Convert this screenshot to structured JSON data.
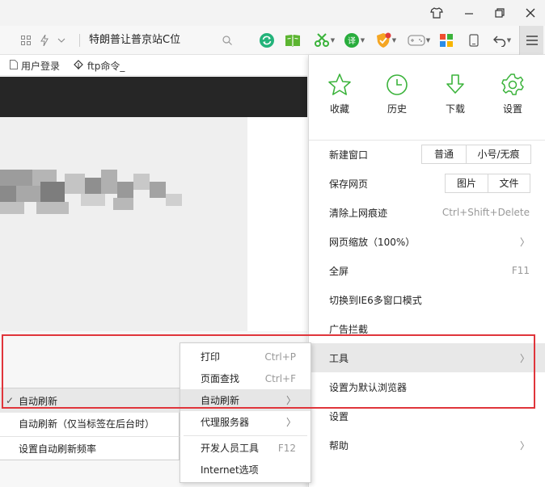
{
  "address_bar": {
    "text": "特朗普让普京站C位"
  },
  "bookmarks": [
    {
      "label": "用户登录",
      "icon": "page-icon"
    },
    {
      "label": "ftp命令_",
      "icon": "baidu-paw-icon"
    }
  ],
  "quick_actions": [
    {
      "label": "收藏",
      "icon": "star-icon"
    },
    {
      "label": "历史",
      "icon": "clock-icon"
    },
    {
      "label": "下载",
      "icon": "download-icon"
    },
    {
      "label": "设置",
      "icon": "gear-icon"
    }
  ],
  "menu": {
    "new_window": {
      "label": "新建窗口",
      "options": [
        "普通",
        "小号/无痕"
      ]
    },
    "save_page": {
      "label": "保存网页",
      "options": [
        "图片",
        "文件"
      ]
    },
    "clear_traces": {
      "label": "清除上网痕迹",
      "shortcut": "Ctrl+Shift+Delete"
    },
    "zoom": {
      "label": "网页缩放（100%）"
    },
    "fullscreen": {
      "label": "全屏",
      "shortcut": "F11"
    },
    "ie6_mode": {
      "label": "切换到IE6多窗口模式"
    },
    "ad_block": {
      "label": "广告拦截"
    },
    "tools": {
      "label": "工具"
    },
    "default_browser": {
      "label": "设置为默认浏览器"
    },
    "settings": {
      "label": "设置"
    },
    "help": {
      "label": "帮助"
    }
  },
  "tools_submenu": {
    "print": {
      "label": "打印",
      "shortcut": "Ctrl+P"
    },
    "find": {
      "label": "页面查找",
      "shortcut": "Ctrl+F"
    },
    "auto_refresh": {
      "label": "自动刷新"
    },
    "proxy": {
      "label": "代理服务器"
    },
    "devtools": {
      "label": "开发人员工具",
      "shortcut": "F12"
    },
    "internet_options": {
      "label": "Internet选项"
    }
  },
  "refresh_submenu": {
    "auto_refresh": {
      "label": "自动刷新",
      "checked": true
    },
    "background_only": {
      "label": "自动刷新（仅当标签在后台时）"
    },
    "set_frequency": {
      "label": "设置自动刷新频率"
    }
  },
  "colors": {
    "highlight_box": "#e0353b",
    "icon_green": "#3bb33b",
    "toolbar_bg": "#f7f7f7"
  }
}
